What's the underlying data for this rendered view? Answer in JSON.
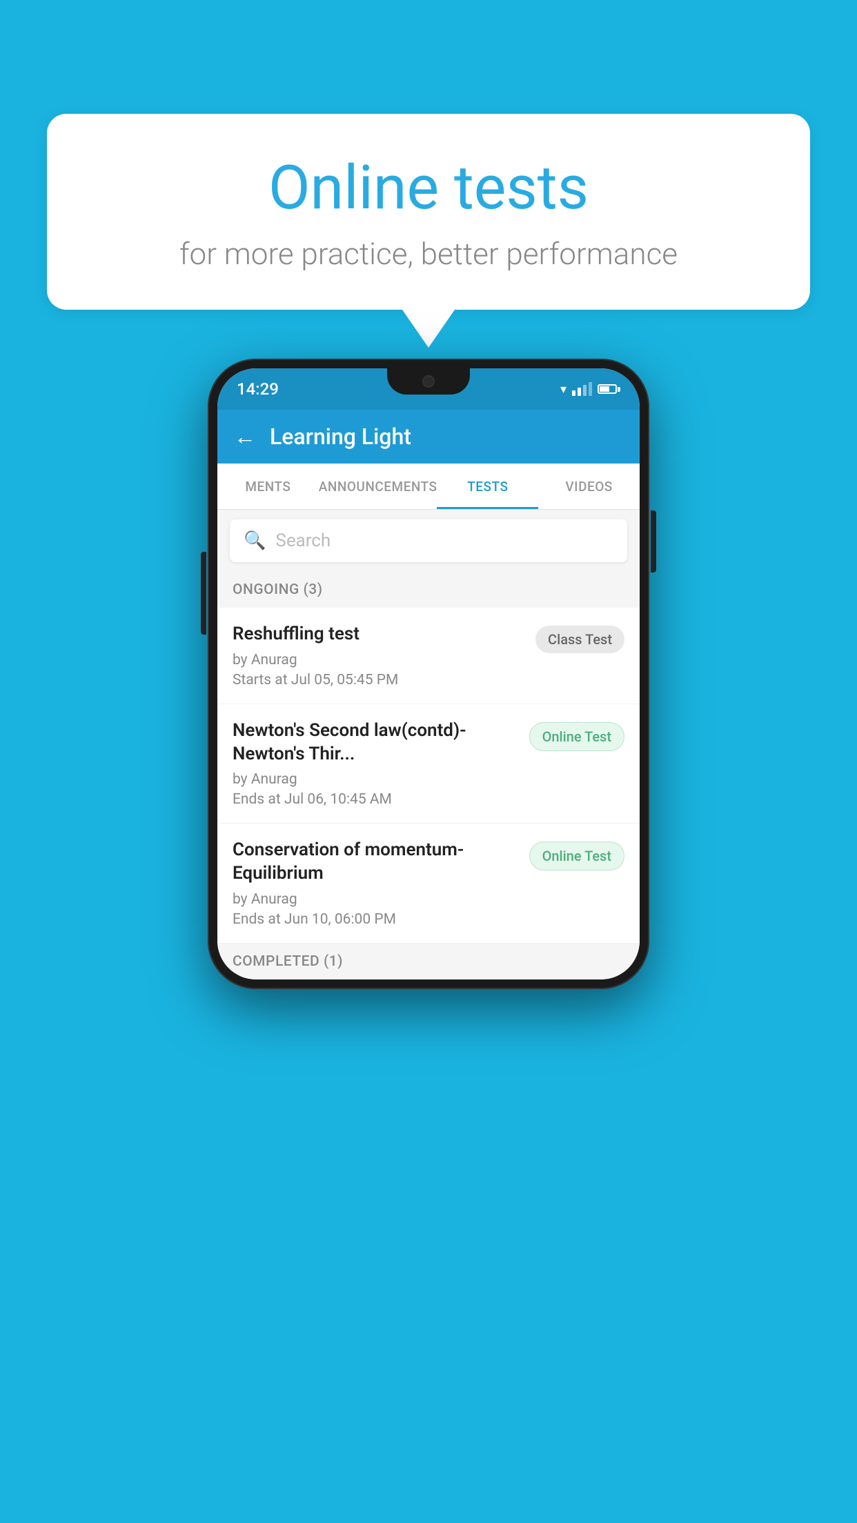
{
  "background_color": "#1ab3e0",
  "speech_bubble": {
    "title": "Online tests",
    "subtitle": "for more practice, better performance"
  },
  "phone": {
    "status_bar": {
      "time": "14:29"
    },
    "app_bar": {
      "title": "Learning Light",
      "back_label": "←"
    },
    "tabs": [
      {
        "label": "MENTS",
        "active": false
      },
      {
        "label": "ANNOUNCEMENTS",
        "active": false
      },
      {
        "label": "TESTS",
        "active": true
      },
      {
        "label": "VIDEOS",
        "active": false
      }
    ],
    "search": {
      "placeholder": "Search"
    },
    "sections": [
      {
        "header": "ONGOING (3)",
        "items": [
          {
            "name": "Reshuffling test",
            "by": "by Anurag",
            "date": "Starts at  Jul 05, 05:45 PM",
            "badge": "Class Test",
            "badge_type": "class"
          },
          {
            "name": "Newton's Second law(contd)-Newton's Thir...",
            "by": "by Anurag",
            "date": "Ends at  Jul 06, 10:45 AM",
            "badge": "Online Test",
            "badge_type": "online"
          },
          {
            "name": "Conservation of momentum-Equilibrium",
            "by": "by Anurag",
            "date": "Ends at  Jun 10, 06:00 PM",
            "badge": "Online Test",
            "badge_type": "online"
          }
        ]
      }
    ],
    "completed_header": "COMPLETED (1)"
  }
}
